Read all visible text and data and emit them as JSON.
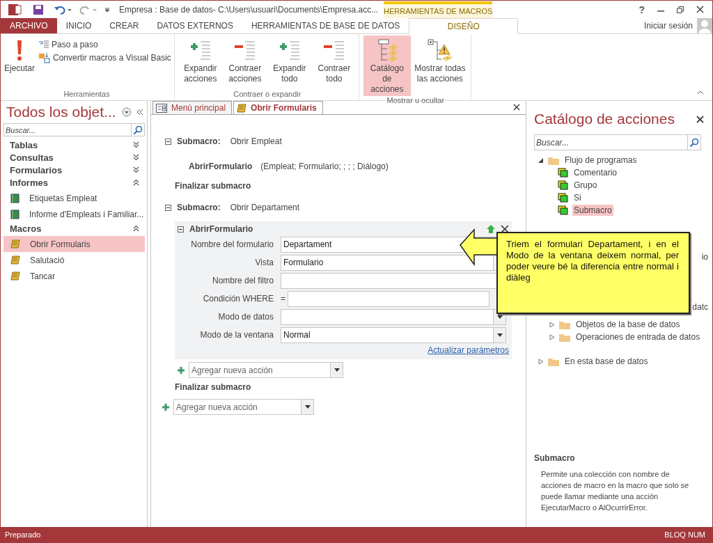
{
  "title_bar": {
    "title": "Empresa : Base de datos- C:\\Users\\usuari\\Documents\\Empresa.acc...",
    "contextual_tab": "HERRAMIENTAS DE MACROS",
    "help": "?",
    "sign_in": "Iniciar sesión"
  },
  "ribbon_tabs": [
    {
      "label": "ARCHIVO",
      "selected": false,
      "kind": "file"
    },
    {
      "label": "INICIO",
      "selected": false,
      "kind": "normal"
    },
    {
      "label": "CREAR",
      "selected": false,
      "kind": "normal"
    },
    {
      "label": "DATOS EXTERNOS",
      "selected": false,
      "kind": "normal"
    },
    {
      "label": "HERRAMIENTAS DE BASE DE DATOS",
      "selected": false,
      "kind": "normal"
    },
    {
      "label": "DISEÑO",
      "selected": true,
      "kind": "contextual"
    }
  ],
  "ribbon_groups": [
    {
      "label": "Herramientas",
      "large": [
        {
          "label": "Ejecutar",
          "selected": false
        }
      ],
      "small": [
        "Paso a paso",
        "Convertir macros a Visual Basic"
      ]
    },
    {
      "label": "Contraer o expandir",
      "large": [
        {
          "label": "Expandir acciones",
          "selected": false
        },
        {
          "label": "Contraer acciones",
          "selected": false
        },
        {
          "label": "Expandir todo",
          "selected": false
        },
        {
          "label": "Contraer todo",
          "selected": false
        }
      ]
    },
    {
      "label": "Mostrar u ocultar",
      "large": [
        {
          "label": "Catálogo de acciones",
          "selected": true
        },
        {
          "label": "Mostrar todas las acciones",
          "selected": false
        }
      ]
    }
  ],
  "nav": {
    "title": "Todos los objet...",
    "search": {
      "placeholder": "Buscar..."
    },
    "groups": [
      {
        "label": "Tablas",
        "expanded": false
      },
      {
        "label": "Consultas",
        "expanded": false
      },
      {
        "label": "Formularios",
        "expanded": false
      },
      {
        "label": "Informes",
        "expanded": true,
        "items": [
          {
            "label": "Etiquetas Empleat",
            "selected": false
          },
          {
            "label": "Informe d'Empleats i Familiar...",
            "selected": false
          }
        ]
      },
      {
        "label": "Macros",
        "expanded": true,
        "items": [
          {
            "label": "Obrir Formularis",
            "selected": true
          },
          {
            "label": "Salutació",
            "selected": false
          },
          {
            "label": "Tancar",
            "selected": false
          }
        ]
      }
    ]
  },
  "document_tabs": [
    {
      "label": "Menú principal",
      "selected": false
    },
    {
      "label": "Obrir Formularis",
      "selected": true
    }
  ],
  "macro": {
    "submacros": [
      {
        "label": "Submacro:",
        "name": "Obrir Empleat",
        "expanded": true,
        "actions": [
          {
            "name": "AbrirFormulario",
            "args": "(Empleat; Formulario; ; ; ; Diálogo)"
          }
        ],
        "end": "Finalizar submacro"
      },
      {
        "label": "Submacro:",
        "name": "Obrir Departament",
        "expanded": true,
        "editor": {
          "name": "AbrirFormulario",
          "fields": [
            {
              "label": "Nombre del formulario",
              "value": "Departament",
              "kind": "combo"
            },
            {
              "label": "Vista",
              "value": "Formulario",
              "kind": "combo"
            },
            {
              "label": "Nombre del filtro",
              "kind": "text"
            },
            {
              "label": "Condición WHERE",
              "prefix": "=",
              "kind": "where"
            },
            {
              "label": "Modo de datos",
              "kind": "combo"
            },
            {
              "label": "Modo de la ventana",
              "value": "Normal",
              "kind": "combo"
            }
          ],
          "link": "Actualizar parámetros"
        },
        "add_action": {
          "placeholder": "Agregar nueva acción"
        },
        "end": "Finalizar submacro"
      }
    ],
    "add_action": {
      "placeholder": "Agregar nueva acción"
    }
  },
  "callout": {
    "text": "Triem el formulari Departament, i en el Modo de la ventana deixem normal, per poder veure bé la diferencia entre normal i diàleg"
  },
  "catalog": {
    "title": "Catálogo de acciones",
    "search": {
      "placeholder": "Buscar..."
    },
    "tree": [
      {
        "label": "Flujo de programas",
        "expanded": true,
        "children": [
          {
            "label": "Comentario",
            "selected": false
          },
          {
            "label": "Grupo",
            "selected": false
          },
          {
            "label": "Si",
            "selected": false
          },
          {
            "label": "Submacro",
            "selected": true
          }
        ]
      }
    ],
    "covered": {
      "fragments": [
        "io",
        "datc"
      ],
      "children": [
        {
          "label": "Objetos de la base de datos",
          "expanded": false
        },
        {
          "label": "Operaciones de entrada de datos",
          "expanded": false
        }
      ]
    },
    "tree_after": [
      {
        "label": "En esta base de datos",
        "expanded": false
      }
    ],
    "help": {
      "title": "Submacro",
      "text": "Permite una colección con nombre de acciones de macro en la macro que solo se puede llamar mediante una acción EjecutarMacro o AlOcurrirError."
    }
  },
  "status_bar": {
    "left": "Preparado",
    "right": "BLOQ NUM"
  }
}
